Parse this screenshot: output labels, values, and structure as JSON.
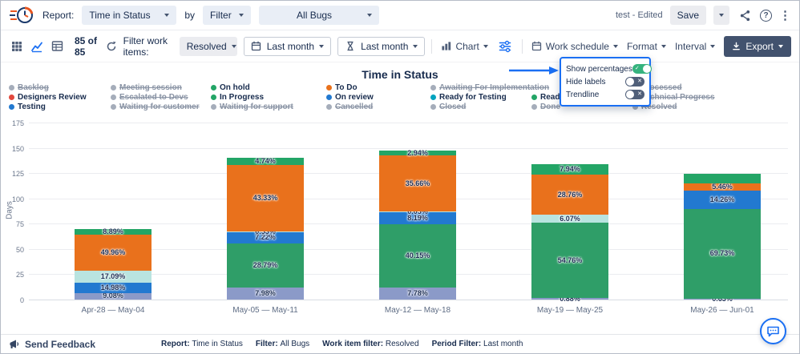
{
  "header": {
    "report_label": "Report:",
    "report_type": "Time in Status",
    "by_label": "by",
    "filter_label": "Filter",
    "scope_label": "All Bugs",
    "doc_state": "test - Edited",
    "save_label": "Save",
    "help_glyph": "?",
    "more_glyph": "⋮"
  },
  "toolbar": {
    "count": "85 of 85",
    "filter_work_items_label": "Filter work items:",
    "work_item_filter": "Resolved",
    "period_calendar": "Last month",
    "period_timer": "Last month",
    "chart": "Chart",
    "work_schedule": "Work schedule",
    "format": "Format",
    "interval": "Interval",
    "export": "Export"
  },
  "settings_menu": {
    "items": [
      {
        "label": "Show percentages",
        "on": true
      },
      {
        "label": "Hide labels",
        "on": false
      },
      {
        "label": "Trendline",
        "on": false
      }
    ]
  },
  "colors": {
    "accent": "#1a6ff3",
    "green": "#23a566",
    "orange": "#e9711c",
    "red": "#e2483d",
    "blue": "#2279d0",
    "teal": "#00a3bf",
    "inactive": "#a5adba"
  },
  "legend": {
    "rows": [
      [
        {
          "label": "Backlog",
          "col": 0,
          "active": false
        },
        {
          "label": "Meeting session",
          "col": 1,
          "active": false
        },
        {
          "label": "On hold",
          "col": 2,
          "active": true,
          "color": "green"
        },
        {
          "label": "To Do",
          "col": 3,
          "active": true,
          "color": "orange"
        },
        {
          "label": "Awaiting For Implementation",
          "col": 4,
          "active": false
        },
        {
          "label": "Processed",
          "col": 6,
          "active": false
        }
      ],
      [
        {
          "label": "Designers Review",
          "col": 0,
          "active": true,
          "color": "red"
        },
        {
          "label": "Escalated to Devs",
          "col": 1,
          "active": false
        },
        {
          "label": "In Progress",
          "col": 2,
          "active": true,
          "color": "green"
        },
        {
          "label": "On review",
          "col": 3,
          "active": true,
          "color": "blue"
        },
        {
          "label": "Ready for Testing",
          "col": 4,
          "active": true,
          "color": "teal"
        },
        {
          "label": "Ready to deploy",
          "col": 5,
          "active": true,
          "color": "green"
        },
        {
          "label": "Technical Progress",
          "col": 6,
          "active": false
        }
      ],
      [
        {
          "label": "Testing",
          "col": 0,
          "active": true,
          "color": "blue"
        },
        {
          "label": "Waiting for customer",
          "col": 1,
          "active": false
        },
        {
          "label": "Waiting for support",
          "col": 2,
          "active": false
        },
        {
          "label": "Cancelled",
          "col": 3,
          "active": false
        },
        {
          "label": "Closed",
          "col": 4,
          "active": false
        },
        {
          "label": "Done",
          "col": 5,
          "active": false
        },
        {
          "label": "Resolved",
          "col": 6,
          "active": false
        }
      ]
    ]
  },
  "chart_data": {
    "type": "stacked-bar",
    "title": "Time in Status",
    "ylabel": "Days",
    "ymax": 175,
    "yticks": [
      0,
      25,
      50,
      75,
      100,
      125,
      150,
      175
    ],
    "grid": true,
    "percent_labels_shown": true,
    "categories": [
      "Apr-28 — May-04",
      "May-05 — May-11",
      "May-12 — May-18",
      "May-19 — May-25",
      "May-26 — Jun-01"
    ],
    "totals_days": [
      70,
      140,
      147,
      134,
      124
    ],
    "segment_colors": {
      "testing": "#8b9ac8",
      "in_progress": "#2f9e68",
      "on_review": "#2279d0",
      "ready_for_testing": "#b9e4e0",
      "to_do": "#e9711c",
      "on_hold": "#23a566"
    },
    "bars": [
      {
        "category": "Apr-28 — May-04",
        "total_days": 70,
        "segments": [
          {
            "status": "Testing",
            "key": "testing",
            "pct": 9.08,
            "label": "9.08%"
          },
          {
            "status": "On review",
            "key": "on_review",
            "pct": 14.98,
            "label": "14.98%"
          },
          {
            "status": "Ready for Testing",
            "key": "ready_for_testing",
            "pct": 17.09,
            "label": "17.09%"
          },
          {
            "status": "To Do",
            "key": "to_do",
            "pct": 49.96,
            "label": "49.96%"
          },
          {
            "status": "On hold",
            "key": "on_hold",
            "pct": 8.89,
            "label": "8.89%"
          }
        ]
      },
      {
        "category": "May-05 — May-11",
        "total_days": 140,
        "segments": [
          {
            "status": "Testing",
            "key": "testing",
            "pct": 7.98,
            "label": "7.98%"
          },
          {
            "status": "In Progress",
            "key": "in_progress",
            "pct": 28.79,
            "label": "28.79%"
          },
          {
            "status": "On review",
            "key": "on_review",
            "pct": 7.22,
            "label": "7.22%"
          },
          {
            "status": "Ready for Testing",
            "key": "ready_for_testing",
            "pct": 0.53,
            "label": "0.53%"
          },
          {
            "status": "To Do",
            "key": "to_do",
            "pct": 43.33,
            "label": "43.33%"
          },
          {
            "status": "On hold",
            "key": "on_hold",
            "pct": 4.74,
            "label": "4.74%"
          }
        ]
      },
      {
        "category": "May-12 — May-18",
        "total_days": 147,
        "segments": [
          {
            "status": "Testing",
            "key": "testing",
            "pct": 7.78,
            "label": "7.78%"
          },
          {
            "status": "In Progress",
            "key": "in_progress",
            "pct": 40.15,
            "label": "40.15%"
          },
          {
            "status": "On review",
            "key": "on_review",
            "pct": 8.19,
            "label": "8.19%"
          },
          {
            "status": "Ready for Testing",
            "key": "ready_for_testing",
            "pct": 0.05,
            "label": "0.05%"
          },
          {
            "status": "To Do",
            "key": "to_do",
            "pct": 35.66,
            "label": "35.66%"
          },
          {
            "status": "On hold",
            "key": "on_hold",
            "pct": 2.94,
            "label": "2.94%"
          }
        ]
      },
      {
        "category": "May-19 — May-25",
        "total_days": 134,
        "segments": [
          {
            "status": "Testing",
            "key": "testing",
            "pct": 0.88,
            "label": "0.88%"
          },
          {
            "status": "In Progress",
            "key": "in_progress",
            "pct": 54.76,
            "label": "54.76%"
          },
          {
            "status": "Ready for Testing",
            "key": "ready_for_testing",
            "pct": 6.07,
            "label": "6.07%"
          },
          {
            "status": "To Do",
            "key": "to_do",
            "pct": 28.76,
            "label": "28.76%"
          },
          {
            "status": "On hold",
            "key": "on_hold",
            "pct": 7.94,
            "label": "7.94%"
          }
        ]
      },
      {
        "category": "May-26 — Jun-01",
        "total_days": 124,
        "segments": [
          {
            "status": "Testing",
            "key": "testing",
            "pct": 0.63,
            "label": "0.63%"
          },
          {
            "status": "In Progress",
            "key": "in_progress",
            "pct": 69.73,
            "label": "69.73%"
          },
          {
            "status": "On review",
            "key": "on_review",
            "pct": 14.26,
            "label": "14.26%"
          },
          {
            "status": "To Do",
            "key": "to_do",
            "pct": 5.46,
            "label": "5.46%"
          },
          {
            "status": "On hold",
            "key": "on_hold",
            "pct": 7.0,
            "label": ""
          }
        ]
      }
    ]
  },
  "footer": {
    "send_feedback": "Send Feedback",
    "summary": [
      {
        "label": "Report:",
        "value": "Time in Status"
      },
      {
        "label": "Filter:",
        "value": "All Bugs"
      },
      {
        "label": "Work item filter:",
        "value": "Resolved"
      },
      {
        "label": "Period Filter:",
        "value": "Last month"
      }
    ]
  }
}
